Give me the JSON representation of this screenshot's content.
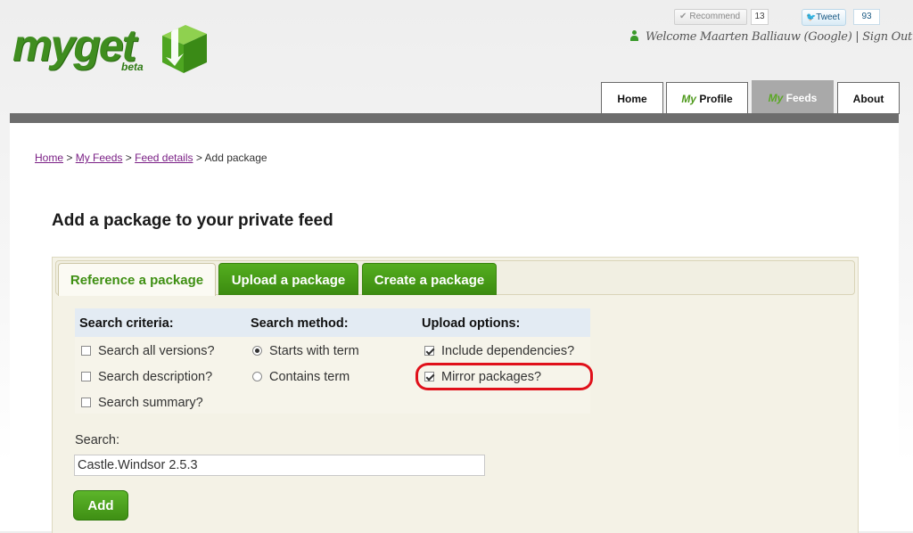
{
  "logo": {
    "my": "my",
    "get": "get",
    "beta": "beta"
  },
  "social": {
    "recommend_label": "Recommend",
    "recommend_count": "13",
    "tweet_label": "Tweet",
    "tweet_count": "93"
  },
  "welcome_text": "Welcome Maarten Balliauw (Google) | Sign Out",
  "nav": {
    "home": "Home",
    "profile_my": "My",
    "profile_rest": " Profile",
    "feeds_my": "My",
    "feeds_rest": " Feeds",
    "about": "About",
    "active": "My Feeds"
  },
  "breadcrumb": {
    "home": "Home",
    "my_feeds": "My Feeds",
    "feed_details": "Feed details",
    "current": "Add package",
    "sep": ">"
  },
  "page_title": "Add a package to your private feed",
  "tabs": [
    {
      "label": "Reference a package",
      "active": true
    },
    {
      "label": "Upload a package",
      "active": false
    },
    {
      "label": "Create a package",
      "active": false
    }
  ],
  "options": {
    "search_criteria": {
      "heading": "Search criteria:",
      "items": [
        {
          "label": "Search all versions?",
          "checked": false
        },
        {
          "label": "Search description?",
          "checked": false
        },
        {
          "label": "Search summary?",
          "checked": false
        }
      ]
    },
    "search_method": {
      "heading": "Search method:",
      "items": [
        {
          "label": "Starts with term",
          "selected": true
        },
        {
          "label": "Contains term",
          "selected": false
        }
      ]
    },
    "upload_options": {
      "heading": "Upload options:",
      "items": [
        {
          "label": "Include dependencies?",
          "checked": true
        },
        {
          "label": "Mirror packages?",
          "checked": true
        }
      ]
    }
  },
  "search": {
    "label": "Search:",
    "value": "Castle.Windsor 2.5.3"
  },
  "add_button": "Add",
  "colors": {
    "brand_green": "#3f8d1f",
    "nav_bar": "#6d6d6d",
    "highlight": "#e0101a",
    "link": "#7a1f85"
  }
}
